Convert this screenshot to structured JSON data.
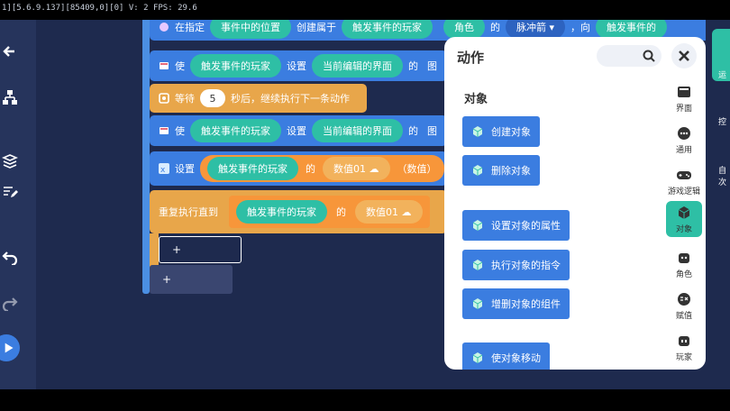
{
  "status_bar": {
    "debug_text": "1][5.6.9.137][85409,0][0] V: 2 FPS: 29.6"
  },
  "blocks": {
    "b1": {
      "prefix": "在指定",
      "p1": "事件中的位置",
      "mid": "创建属于",
      "p2": "触发事件的玩家",
      "p3": "角色",
      "of": "的",
      "p4": "脉冲箭",
      "dir": "，向",
      "p5": "触发事件的"
    },
    "b2": {
      "prefix": "使",
      "p1": "触发事件的玩家",
      "mid": "设置",
      "p2": "当前编辑的界面",
      "of": "的",
      "tail": "图"
    },
    "b3": {
      "prefix": "等待",
      "num": "5",
      "suffix": "秒后，继续执行下一条动作"
    },
    "b4": {
      "prefix": "使",
      "p1": "触发事件的玩家",
      "mid": "设置",
      "p2": "当前编辑的界面",
      "of": "的",
      "tail": "图"
    },
    "b5": {
      "prefix": "设置",
      "p1": "触发事件的玩家",
      "of": "的",
      "p2": "数值01",
      "paren": "（数值）"
    },
    "b6": {
      "prefix": "重复执行直到",
      "p1": "触发事件的玩家",
      "of": "的",
      "p2": "数值01"
    },
    "slot_plus": "+",
    "slot_plus2": "+"
  },
  "panel": {
    "title": "动作",
    "section": "对象",
    "actions": [
      "创建对象",
      "删除对象",
      "设置对象的属性",
      "执行对象的指令",
      "增删对象的组件",
      "使对象移动"
    ],
    "categories": [
      {
        "label": "界面",
        "icon": "screen-icon"
      },
      {
        "label": "通用",
        "icon": "dots-icon"
      },
      {
        "label": "游戏逻辑",
        "icon": "gamepad-icon"
      },
      {
        "label": "对象",
        "icon": "cube-icon",
        "active": true
      },
      {
        "label": "角色",
        "icon": "character-icon"
      },
      {
        "label": "赋值",
        "icon": "assign-icon"
      },
      {
        "label": "玩家",
        "icon": "player-icon"
      }
    ]
  },
  "far_right": {
    "tab1": "运",
    "tab2": "控",
    "tab3": "自次"
  },
  "colors": {
    "canvas": "#1e2a4e",
    "block_blue": "#3b7de0",
    "block_orange": "#e8a64a",
    "pill_teal": "#2ebfa5",
    "pill_orange": "#f7963a"
  }
}
